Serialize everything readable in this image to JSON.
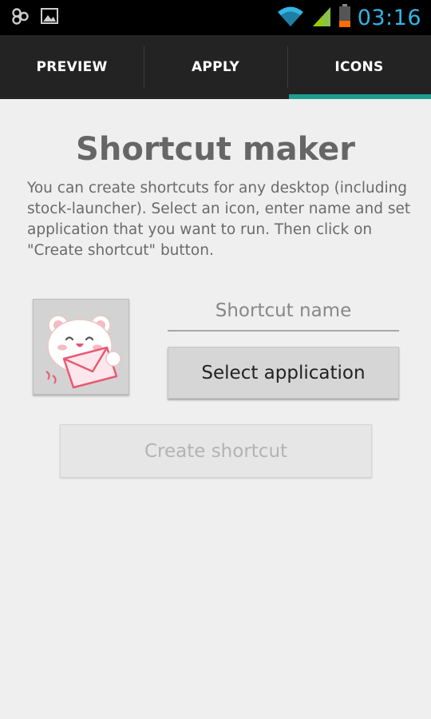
{
  "status_bar": {
    "time": "03:16",
    "icons": [
      "notification-app-icon",
      "image-icon",
      "wifi-icon",
      "signal-icon",
      "battery-icon"
    ],
    "accent": "#33b5e5"
  },
  "tabs": [
    {
      "label": "PREVIEW",
      "selected": false
    },
    {
      "label": "APPLY",
      "selected": false
    },
    {
      "label": "ICONS",
      "selected": true
    }
  ],
  "tab_indicator_color": "#1e9e8f",
  "main": {
    "title": "Shortcut maker",
    "description": "You can create shortcuts for any desktop (including stock-launcher). Select an icon, enter name and set application that you want to run. Then click on \"Create shortcut\" button.",
    "icon_preview": "bear-with-envelope-icon",
    "name_input": {
      "placeholder": "Shortcut name",
      "value": ""
    },
    "select_button": "Select application",
    "create_button": "Create shortcut",
    "create_enabled": false
  }
}
